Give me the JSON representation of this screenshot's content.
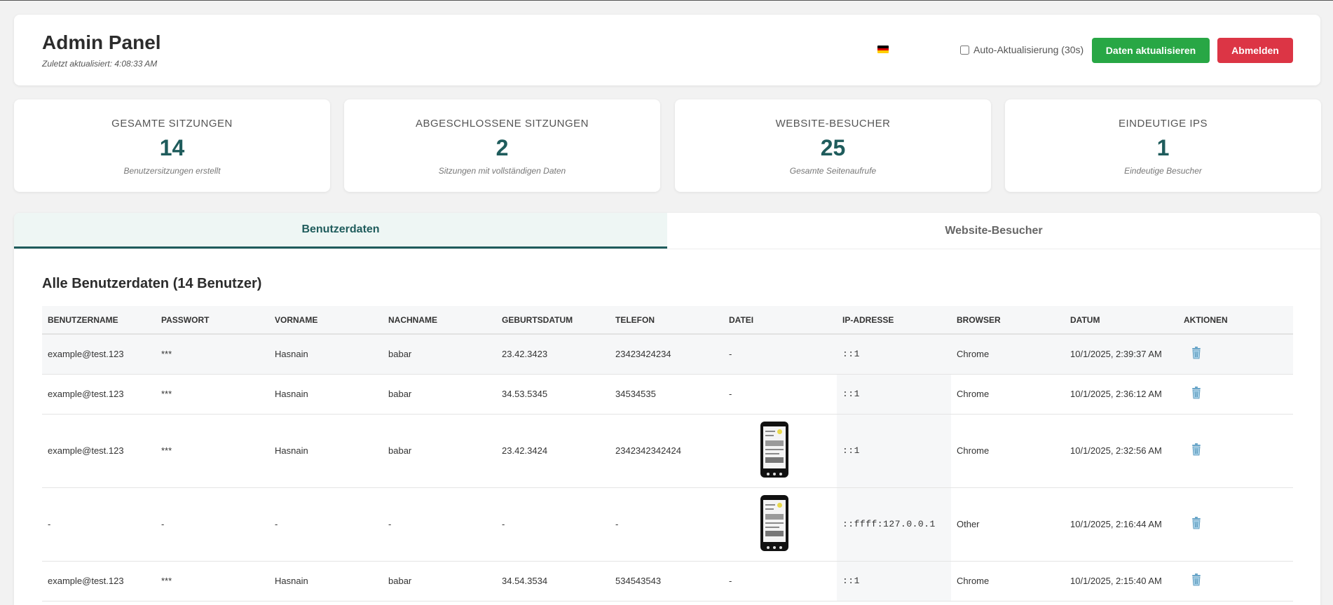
{
  "header": {
    "title": "Admin Panel",
    "updated": "Zuletzt aktualisiert: 4:08:33 AM",
    "auto_refresh_label": "Auto-Aktualisierung (30s)",
    "refresh_button": "Daten aktualisieren",
    "logout_button": "Abmelden",
    "flag_icon": "german-flag-icon"
  },
  "stats": [
    {
      "label": "Gesamte Sitzungen",
      "value": "14",
      "desc": "Benutzersitzungen erstellt"
    },
    {
      "label": "Abgeschlossene Sitzungen",
      "value": "2",
      "desc": "Sitzungen mit vollständigen Daten"
    },
    {
      "label": "Website-Besucher",
      "value": "25",
      "desc": "Gesamte Seitenaufrufe"
    },
    {
      "label": "Eindeutige IPs",
      "value": "1",
      "desc": "Eindeutige Besucher"
    }
  ],
  "tabs": [
    {
      "label": "Benutzerdaten",
      "active": true
    },
    {
      "label": "Website-Besucher",
      "active": false
    }
  ],
  "table": {
    "title": "Alle Benutzerdaten (14 Benutzer)",
    "columns": [
      "Benutzername",
      "Passwort",
      "Vorname",
      "Nachname",
      "Geburtsdatum",
      "Telefon",
      "Datei",
      "IP-Adresse",
      "Browser",
      "Datum",
      "Aktionen"
    ],
    "rows": [
      {
        "username": "example@test.123",
        "password": "***",
        "first": "Hasnain",
        "last": "babar",
        "dob": "23.42.3423",
        "phone": "23423424234",
        "file": "-",
        "ip": "::1",
        "browser": "Chrome",
        "date": "10/1/2025, 2:39:37 AM"
      },
      {
        "username": "example@test.123",
        "password": "***",
        "first": "Hasnain",
        "last": "babar",
        "dob": "34.53.5345",
        "phone": "34534535",
        "file": "-",
        "ip": "::1",
        "browser": "Chrome",
        "date": "10/1/2025, 2:36:12 AM"
      },
      {
        "username": "example@test.123",
        "password": "***",
        "first": "Hasnain",
        "last": "babar",
        "dob": "23.42.3424",
        "phone": "2342342342424",
        "file": "image",
        "ip": "::1",
        "browser": "Chrome",
        "date": "10/1/2025, 2:32:56 AM"
      },
      {
        "username": "-",
        "password": "-",
        "first": "-",
        "last": "-",
        "dob": "-",
        "phone": "-",
        "file": "image",
        "ip": "::ffff:127.0.0.1",
        "browser": "Other",
        "date": "10/1/2025, 2:16:44 AM"
      },
      {
        "username": "example@test.123",
        "password": "***",
        "first": "Hasnain",
        "last": "babar",
        "dob": "34.54.3534",
        "phone": "534543543",
        "file": "-",
        "ip": "::1",
        "browser": "Chrome",
        "date": "10/1/2025, 2:15:40 AM"
      }
    ]
  },
  "colors": {
    "accent": "#1f5c5c",
    "success": "#28a745",
    "danger": "#dc3545"
  }
}
